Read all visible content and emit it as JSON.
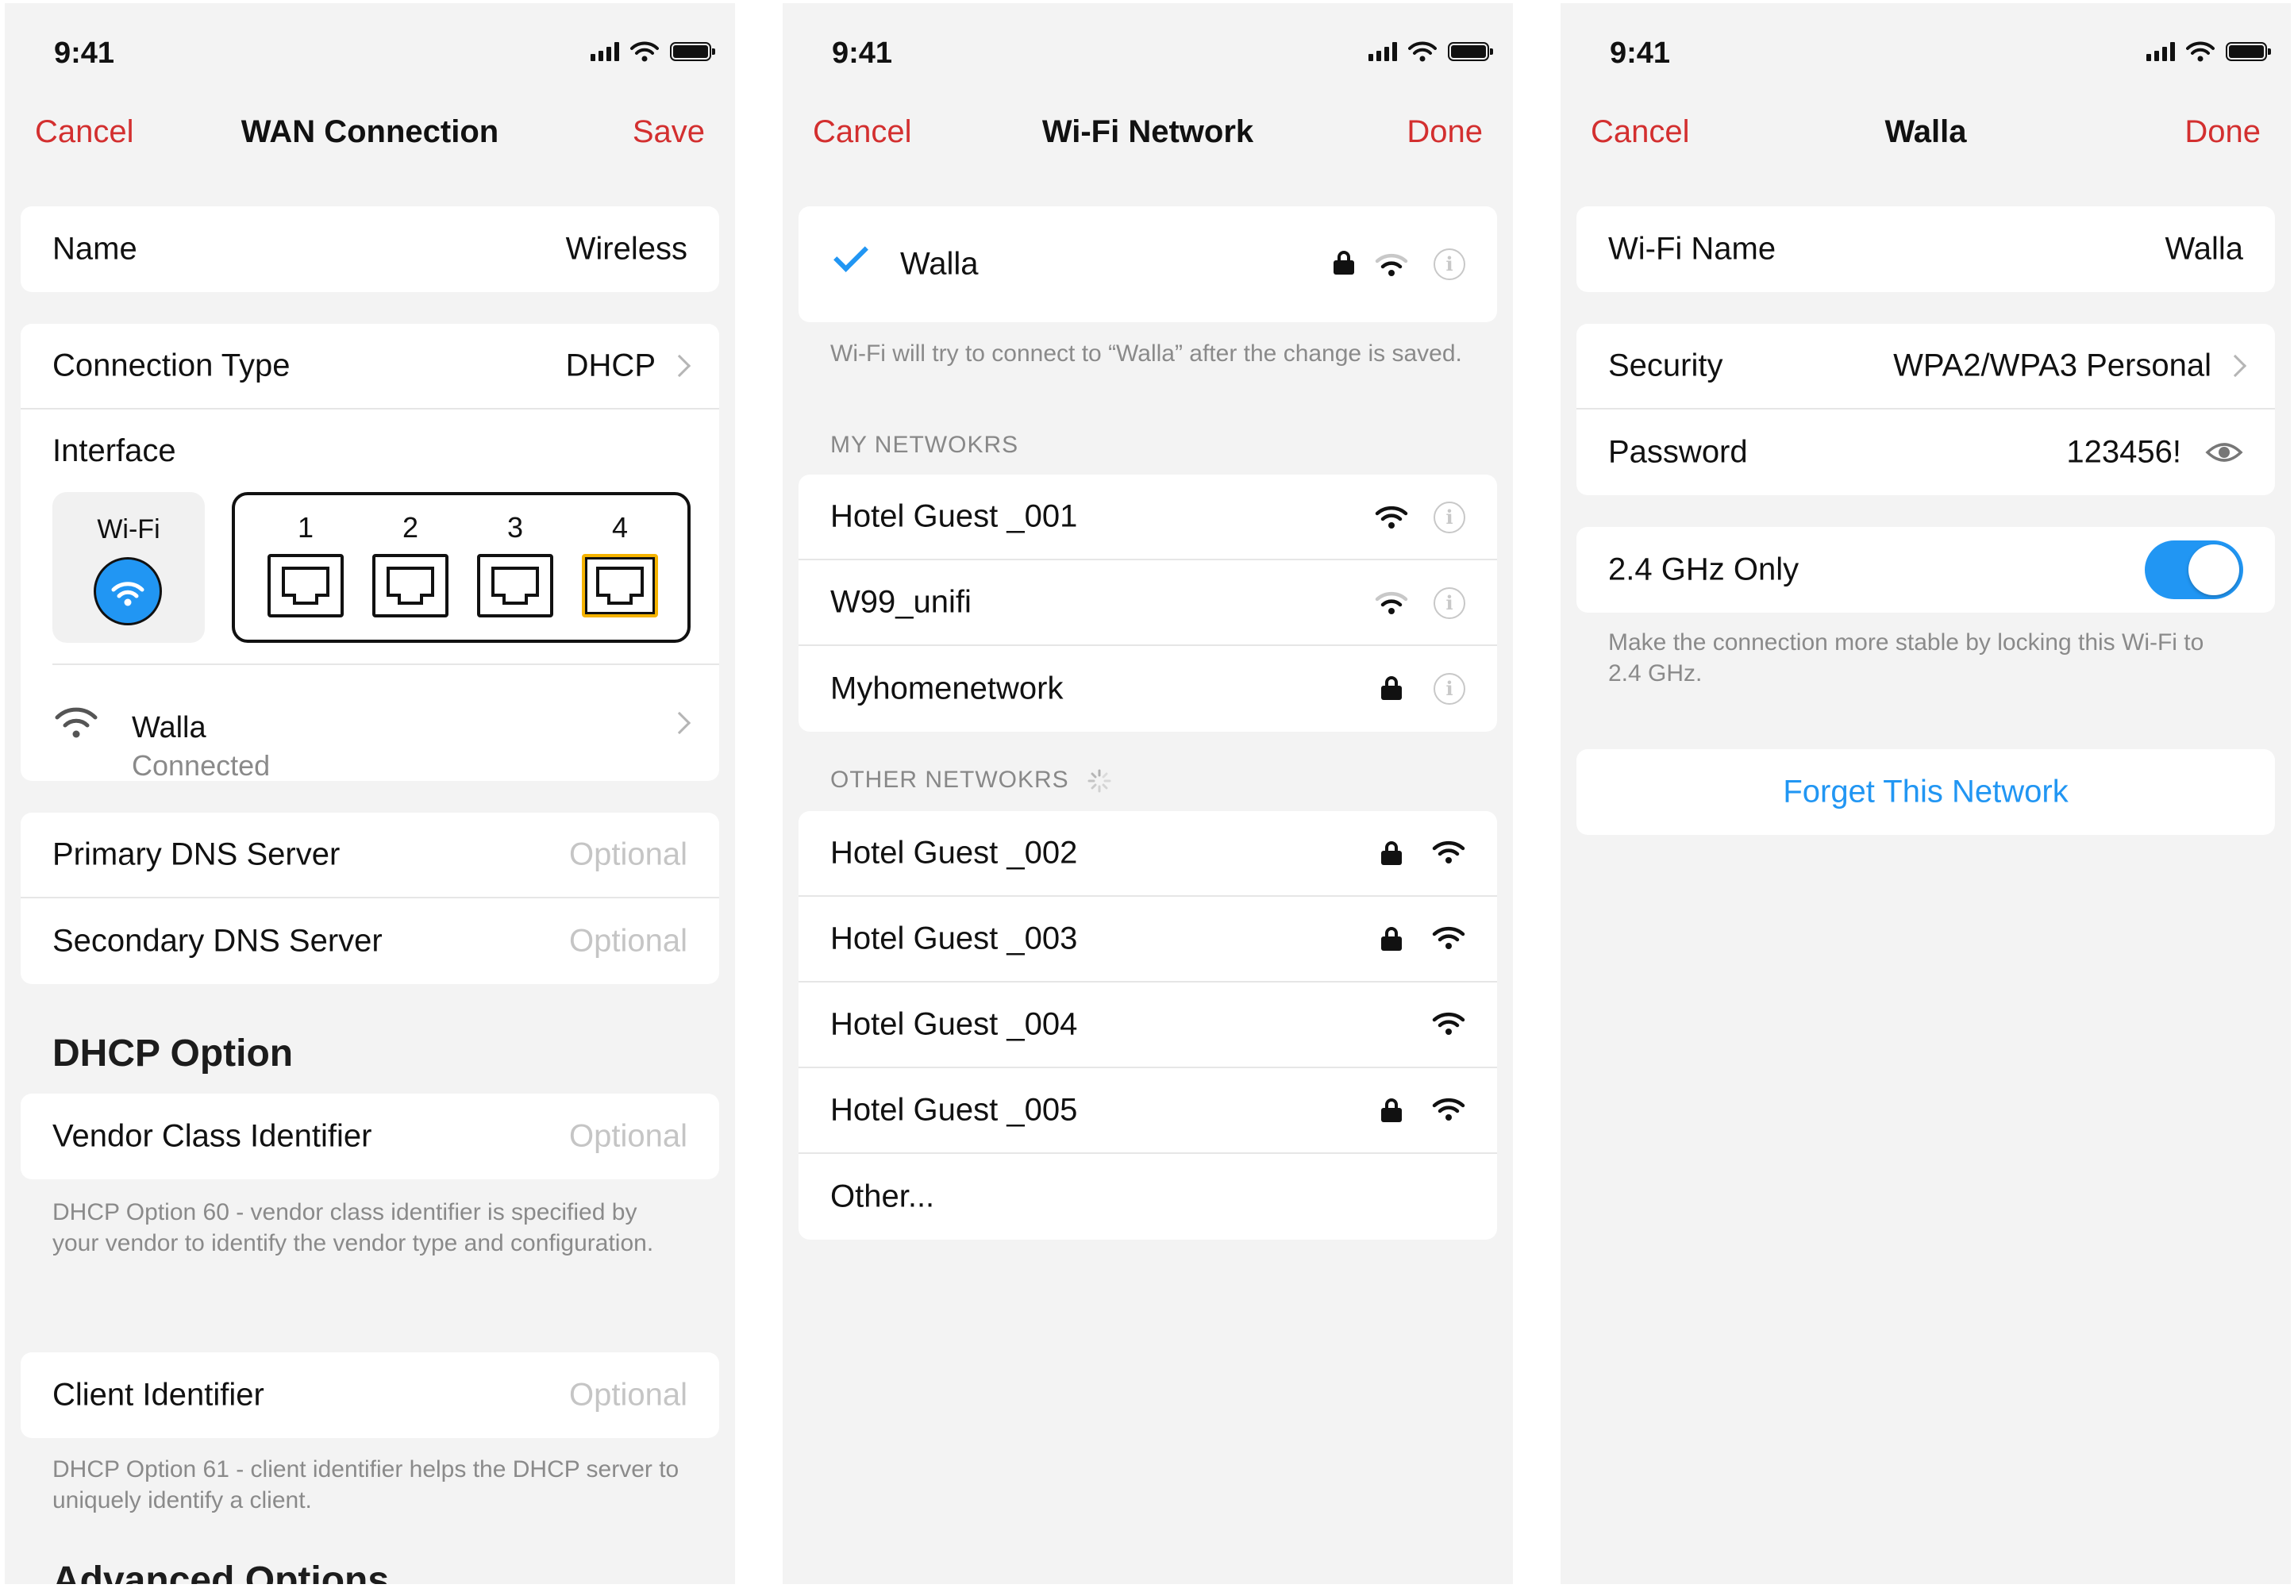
{
  "status": {
    "time": "9:41"
  },
  "screen1": {
    "nav": {
      "cancel": "Cancel",
      "title": "WAN Connection",
      "save": "Save"
    },
    "name": {
      "label": "Name",
      "value": "Wireless"
    },
    "connection_type": {
      "label": "Connection Type",
      "value": "DHCP"
    },
    "interface": {
      "label": "Interface",
      "wifi_label": "Wi-Fi",
      "ports": [
        "1",
        "2",
        "3",
        "4"
      ],
      "selected_port": "4"
    },
    "wan_network": {
      "name": "Walla",
      "status": "Connected"
    },
    "dns": {
      "primary": {
        "label": "Primary DNS Server",
        "placeholder": "Optional"
      },
      "secondary": {
        "label": "Secondary DNS Server",
        "placeholder": "Optional"
      }
    },
    "dhcp_header": "DHCP Option",
    "vendor": {
      "label": "Vendor Class Identifier",
      "placeholder": "Optional",
      "note": "DHCP Option 60 - vendor class identifier is specified by your vendor to identify the vendor type and configuration."
    },
    "client": {
      "label": "Client Identifier",
      "placeholder": "Optional",
      "note": "DHCP Option 61 - client identifier helps the DHCP server to uniquely identify a client."
    },
    "advanced_header": "Advanced Options"
  },
  "screen2": {
    "nav": {
      "cancel": "Cancel",
      "title": "Wi-Fi Network",
      "done": "Done"
    },
    "current": {
      "name": "Walla",
      "note": "Wi-Fi will try to connect to “Walla” after the change is saved."
    },
    "my_header": "MY NETWOKRS",
    "my_networks": [
      {
        "name": "Hotel Guest _001",
        "locked": false,
        "signal": "strong"
      },
      {
        "name": "W99_unifi",
        "locked": false,
        "signal": "medium"
      },
      {
        "name": "Myhomenetwork",
        "locked": true,
        "signal": "none"
      }
    ],
    "other_header": "OTHER NETWOKRS",
    "other_networks": [
      {
        "name": "Hotel Guest _002",
        "locked": true
      },
      {
        "name": "Hotel Guest _003",
        "locked": true
      },
      {
        "name": "Hotel Guest _004",
        "locked": false
      },
      {
        "name": "Hotel Guest _005",
        "locked": true
      }
    ],
    "other_entry": "Other..."
  },
  "screen3": {
    "nav": {
      "cancel": "Cancel",
      "title": "Walla",
      "done": "Done"
    },
    "wifi_name": {
      "label": "Wi-Fi Name",
      "value": "Walla"
    },
    "security": {
      "label": "Security",
      "value": "WPA2/WPA3 Personal"
    },
    "password": {
      "label": "Password",
      "value": "123456!"
    },
    "band": {
      "label": "2.4 GHz Only",
      "enabled": true,
      "note": "Make the connection more stable by locking this Wi-Fi to 2.4 GHz."
    },
    "forget": "Forget This Network"
  },
  "colors": {
    "accent_red": "#d32f2f",
    "accent_blue": "#2196f3",
    "port_highlight": "#f5b300"
  }
}
